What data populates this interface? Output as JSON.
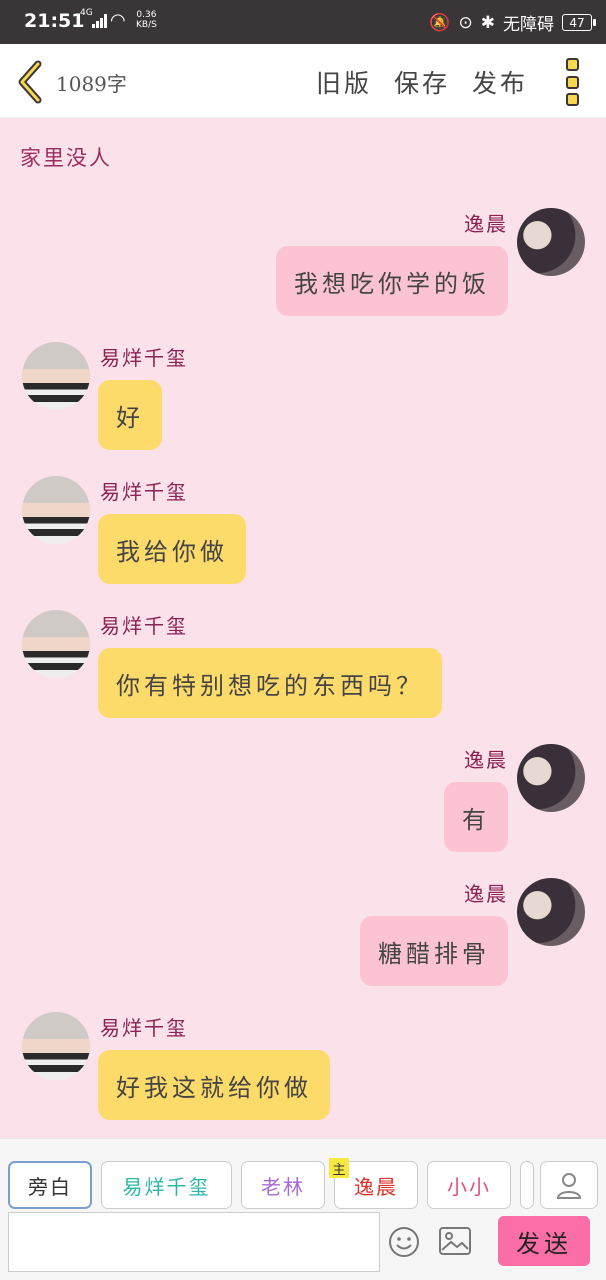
{
  "status_bar": {
    "time": "21:51",
    "network": "4G",
    "speed_value": "0.36",
    "speed_unit": "KB/S",
    "accessibility": "无障碍",
    "battery": "47"
  },
  "toolbar": {
    "word_count": "1089字",
    "old_version": "旧版",
    "save": "保存",
    "publish": "发布"
  },
  "scene_title": "家里没人",
  "messages": [
    {
      "side": "right",
      "name": "逸晨",
      "text": "我想吃你学的饭"
    },
    {
      "side": "left",
      "name": "易烊千玺",
      "text": "好"
    },
    {
      "side": "left",
      "name": "易烊千玺",
      "text": "我给你做"
    },
    {
      "side": "left",
      "name": "易烊千玺",
      "text": "你有特别想吃的东西吗？"
    },
    {
      "side": "right",
      "name": "逸晨",
      "text": "有"
    },
    {
      "side": "right",
      "name": "逸晨",
      "text": "糖醋排骨"
    },
    {
      "side": "left",
      "name": "易烊千玺",
      "text": "好我这就给你做"
    }
  ],
  "characters": [
    {
      "label": "旁白",
      "color": "#333333"
    },
    {
      "label": "易烊千玺",
      "color": "#2bb7a6"
    },
    {
      "label": "老林",
      "color": "#a86bd1"
    },
    {
      "label": "逸晨",
      "color": "#d9332b",
      "tag": "主"
    },
    {
      "label": "小小",
      "color": "#e0507a"
    }
  ],
  "input": {
    "placeholder": "",
    "send_label": "发送"
  },
  "colors": {
    "background": "#fbe1ea",
    "left_bubble": "#fddb6b",
    "right_bubble": "#fcc4d2",
    "send_button": "#fb6fa6",
    "name_color": "#8a2252"
  }
}
